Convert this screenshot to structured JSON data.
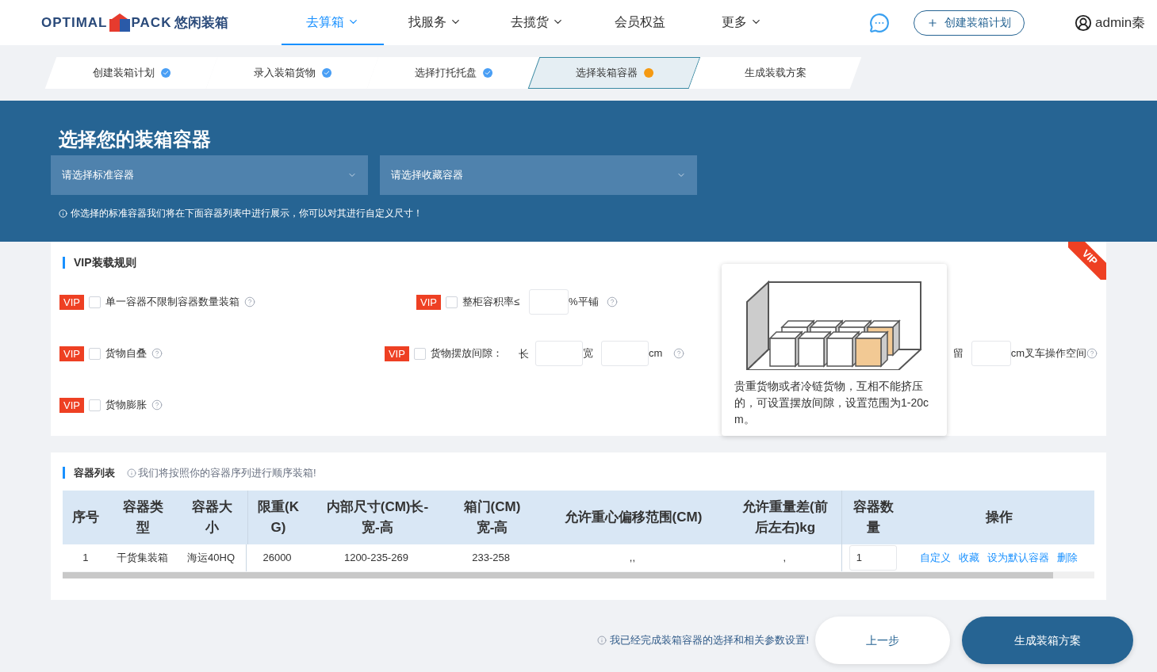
{
  "header": {
    "logo": {
      "word1": "OPTIMAL",
      "word2": "PACK",
      "cn": "悠闲装箱"
    },
    "nav": [
      {
        "label": "去算箱",
        "selected": true,
        "has_menu": true
      },
      {
        "label": "找服务",
        "selected": false,
        "has_menu": true
      },
      {
        "label": "去揽货",
        "selected": false,
        "has_menu": true
      },
      {
        "label": "会员权益",
        "selected": false,
        "has_menu": false
      },
      {
        "label": "更多",
        "selected": false,
        "has_menu": true
      }
    ],
    "create_button": "创建装箱计划",
    "user": "admin秦"
  },
  "steps": [
    {
      "label": "创建装箱计划",
      "done": true,
      "selected": false
    },
    {
      "label": "录入装箱货物",
      "done": true,
      "selected": false
    },
    {
      "label": "选择打托托盘",
      "done": true,
      "selected": false
    },
    {
      "label": "选择装箱容器",
      "done": false,
      "selected": true
    },
    {
      "label": "生成装载方案",
      "done": false,
      "selected": false
    }
  ],
  "banner": {
    "title": "选择您的装箱容器",
    "selects": [
      {
        "placeholder": "请选择标准容器"
      },
      {
        "placeholder": "请选择收藏容器"
      }
    ],
    "note": "你选择的标准容器我们将在下面容器列表中进行展示，你可以对其进行自定义尺寸！"
  },
  "vip_rules": {
    "title": "VIP装载规则",
    "ribbon": "VIP",
    "rows": [
      [
        {
          "kind": "plain",
          "badge": "VIP",
          "checked": false,
          "label": "单一容器不限制容器数量装箱"
        },
        {
          "kind": "ratio",
          "badge": "VIP",
          "checked": false,
          "label": "整柜容积率≤",
          "suffix": "%平铺"
        }
      ],
      [
        {
          "kind": "plain",
          "badge": "VIP",
          "checked": false,
          "label": "货物自叠"
        },
        {
          "kind": "gap",
          "badge": "VIP",
          "checked": false,
          "label": "货物摆放间隙：",
          "length_label": "长",
          "width_label": "宽",
          "unit": "cm"
        },
        {
          "kind": "forklift",
          "prefix": "留",
          "suffix": "cm叉车操作空间"
        }
      ],
      [
        {
          "kind": "plain",
          "badge": "VIP",
          "checked": false,
          "label": "货物膨胀"
        }
      ]
    ],
    "tooltip": "贵重货物或者冷链货物，互相不能挤压的，可设置摆放间隙，设置范围为1-20cm。"
  },
  "container_list": {
    "title": "容器列表",
    "hint": "我们将按照你的容器序列进行顺序装箱!",
    "columns": [
      "序号",
      "容器类型",
      "容器大小",
      "限重(KG)",
      "内部尺寸(CM)长-宽-高",
      "箱门(CM)宽-高",
      "允许重心偏移范围(CM)",
      "允许重量差(前后左右)kg",
      "容器数量",
      "操作"
    ],
    "rows": [
      {
        "cells": [
          "1",
          "干货集装箱",
          "海运40HQ",
          "26000",
          "1200-235-269",
          "233-258",
          ",,",
          ","
        ],
        "quantity": "1",
        "actions": [
          "自定义",
          "收藏",
          "设为默认容器",
          "删除"
        ]
      }
    ]
  },
  "footer": {
    "note": "我已经完成装箱容器的选择和相关参数设置!",
    "prev": "上一步",
    "next": "生成装箱方案"
  }
}
